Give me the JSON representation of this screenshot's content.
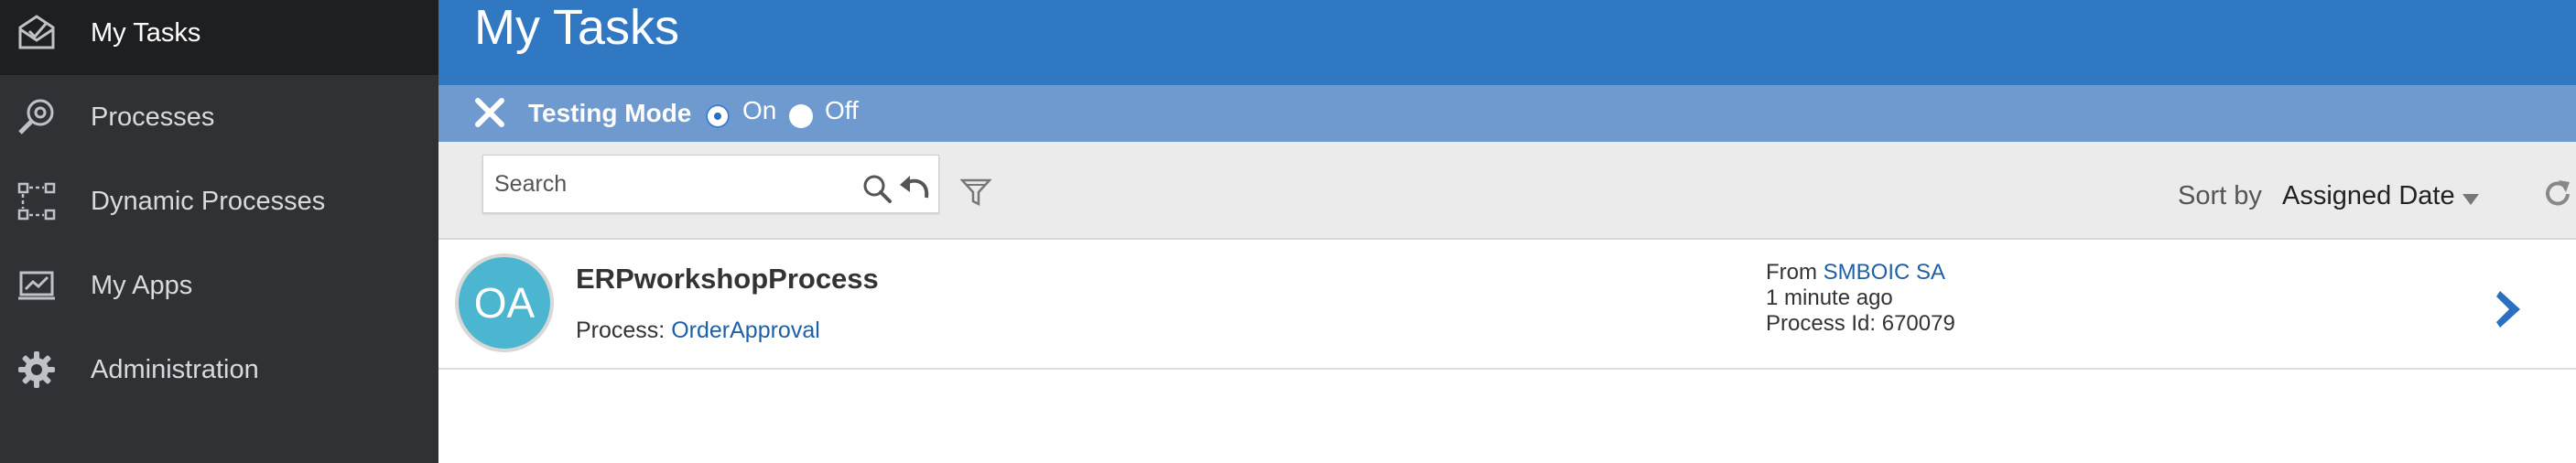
{
  "sidebar": {
    "items": [
      {
        "label": "My Tasks",
        "icon": "inbox-icon"
      },
      {
        "label": "Processes",
        "icon": "search-gear-icon"
      },
      {
        "label": "Dynamic Processes",
        "icon": "dynamic-flow-icon"
      },
      {
        "label": "My Apps",
        "icon": "chart-monitor-icon"
      },
      {
        "label": "Administration",
        "icon": "gear-icon"
      }
    ]
  },
  "header": {
    "title": "My Tasks"
  },
  "testing": {
    "label": "Testing Mode",
    "on_label": "On",
    "off_label": "Off",
    "selected": "On"
  },
  "toolbar": {
    "search_placeholder": "Search",
    "sort_label": "Sort by",
    "sort_value": "Assigned Date"
  },
  "tasks": [
    {
      "avatar": "OA",
      "name": "ERPworkshopProcess",
      "process_label": "Process:",
      "process_name": "OrderApproval",
      "from_label": "From",
      "from_name": "SMBOIC SA",
      "time": "1 minute ago",
      "process_id": "Process Id: 670079"
    }
  ],
  "colors": {
    "sidebar": "#2f3135",
    "header": "#3178c2",
    "testbar": "#6f9ad0",
    "avatar": "#4cb6d0",
    "link": "#1f5fa8"
  }
}
